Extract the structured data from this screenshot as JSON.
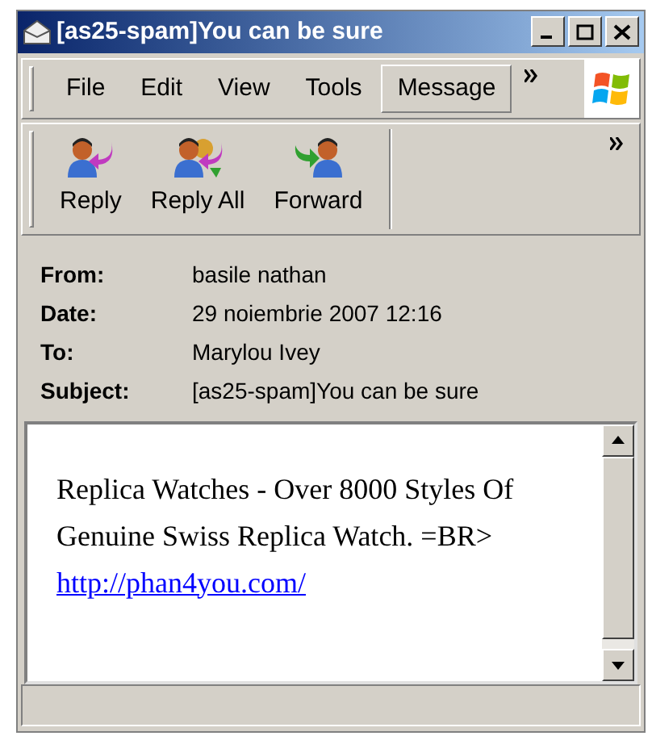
{
  "window": {
    "title": "[as25-spam]You can be sure"
  },
  "menu": [
    {
      "label": "File",
      "selected": false
    },
    {
      "label": "Edit",
      "selected": false
    },
    {
      "label": "View",
      "selected": false
    },
    {
      "label": "Tools",
      "selected": false
    },
    {
      "label": "Message",
      "selected": true
    }
  ],
  "toolbar": [
    {
      "label": "Reply",
      "kind": "reply"
    },
    {
      "label": "Reply All",
      "kind": "reply_all"
    },
    {
      "label": "Forward",
      "kind": "forward"
    }
  ],
  "header": [
    {
      "label": "From:",
      "value": "basile nathan"
    },
    {
      "label": "Date:",
      "value": "29 noiembrie 2007 12:16"
    },
    {
      "label": "To:",
      "value": "Marylou Ivey"
    },
    {
      "label": "Subject:",
      "value": "[as25-spam]You can be sure"
    }
  ],
  "body": {
    "text": "Replica Watches - Over 8000 Styles Of Genuine Swiss Replica Watch. =BR>",
    "link": "http://phan4you.com/"
  }
}
